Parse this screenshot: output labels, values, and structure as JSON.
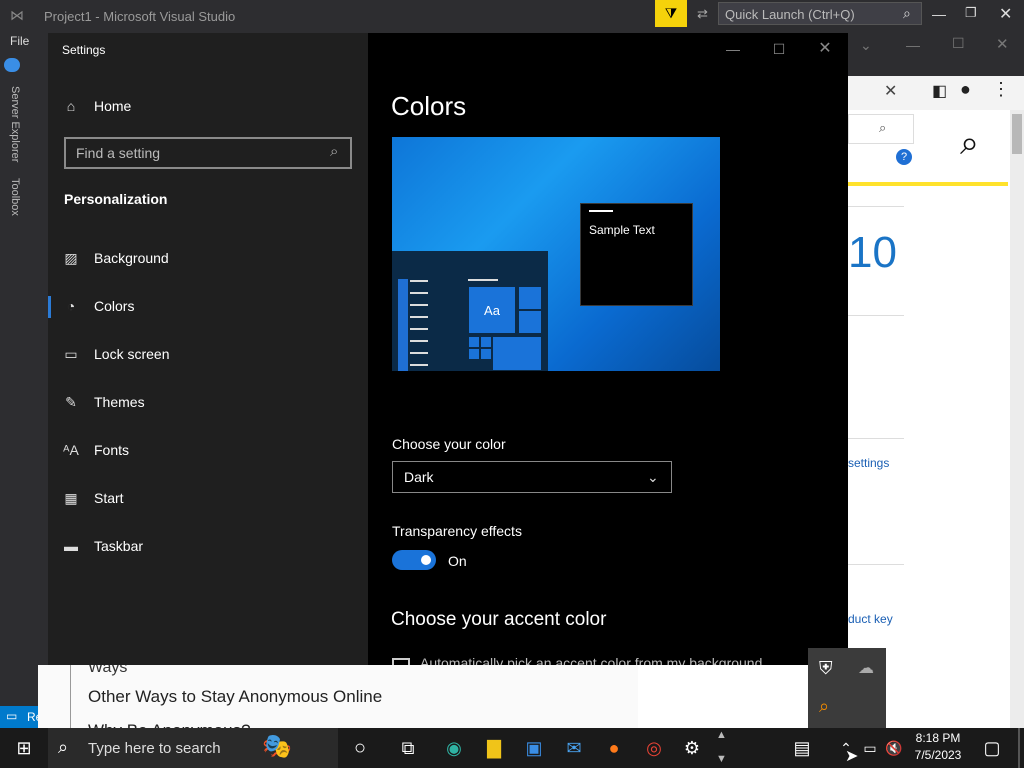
{
  "vs": {
    "title": "Project1 - Microsoft Visual Studio",
    "quick_launch": "Quick Launch (Ctrl+Q)",
    "menu_file": "File",
    "side_server_explorer": "Server Explorer",
    "side_toolbox": "Toolbox",
    "side_bottom": "Re"
  },
  "browser": {
    "big_number": "10",
    "link_settings": "settings",
    "link_product_key": "duct key"
  },
  "web": {
    "heading": "Other Ways to Stay Anonymous Online",
    "line_partial": "Why Be Anonymous?",
    "top_partial": "Ways"
  },
  "settings": {
    "window_title": "Settings",
    "home_label": "Home",
    "search_placeholder": "Find a setting",
    "section_title": "Personalization",
    "nav_items": [
      {
        "label": "Background",
        "icon": "image-icon"
      },
      {
        "label": "Colors",
        "icon": "palette-icon"
      },
      {
        "label": "Lock screen",
        "icon": "lock-screen-icon"
      },
      {
        "label": "Themes",
        "icon": "themes-icon"
      },
      {
        "label": "Fonts",
        "icon": "fonts-icon"
      },
      {
        "label": "Start",
        "icon": "start-icon"
      },
      {
        "label": "Taskbar",
        "icon": "taskbar-icon"
      }
    ],
    "page_title": "Colors",
    "sample_text": "Sample Text",
    "tile_label": "Aa",
    "choose_color_label": "Choose your color",
    "choose_color_value": "Dark",
    "transparency_label": "Transparency effects",
    "transparency_value": "On",
    "accent_heading": "Choose your accent color",
    "auto_accent_partial": "Automatically pick an accent color from my background"
  },
  "taskbar": {
    "search_placeholder": "Type here to search",
    "time": "8:18 PM",
    "date": "7/5/2023"
  },
  "colors": {
    "accent": "#1a73d9",
    "nav_bg": "#1f1f1f",
    "content_bg": "#000000"
  }
}
